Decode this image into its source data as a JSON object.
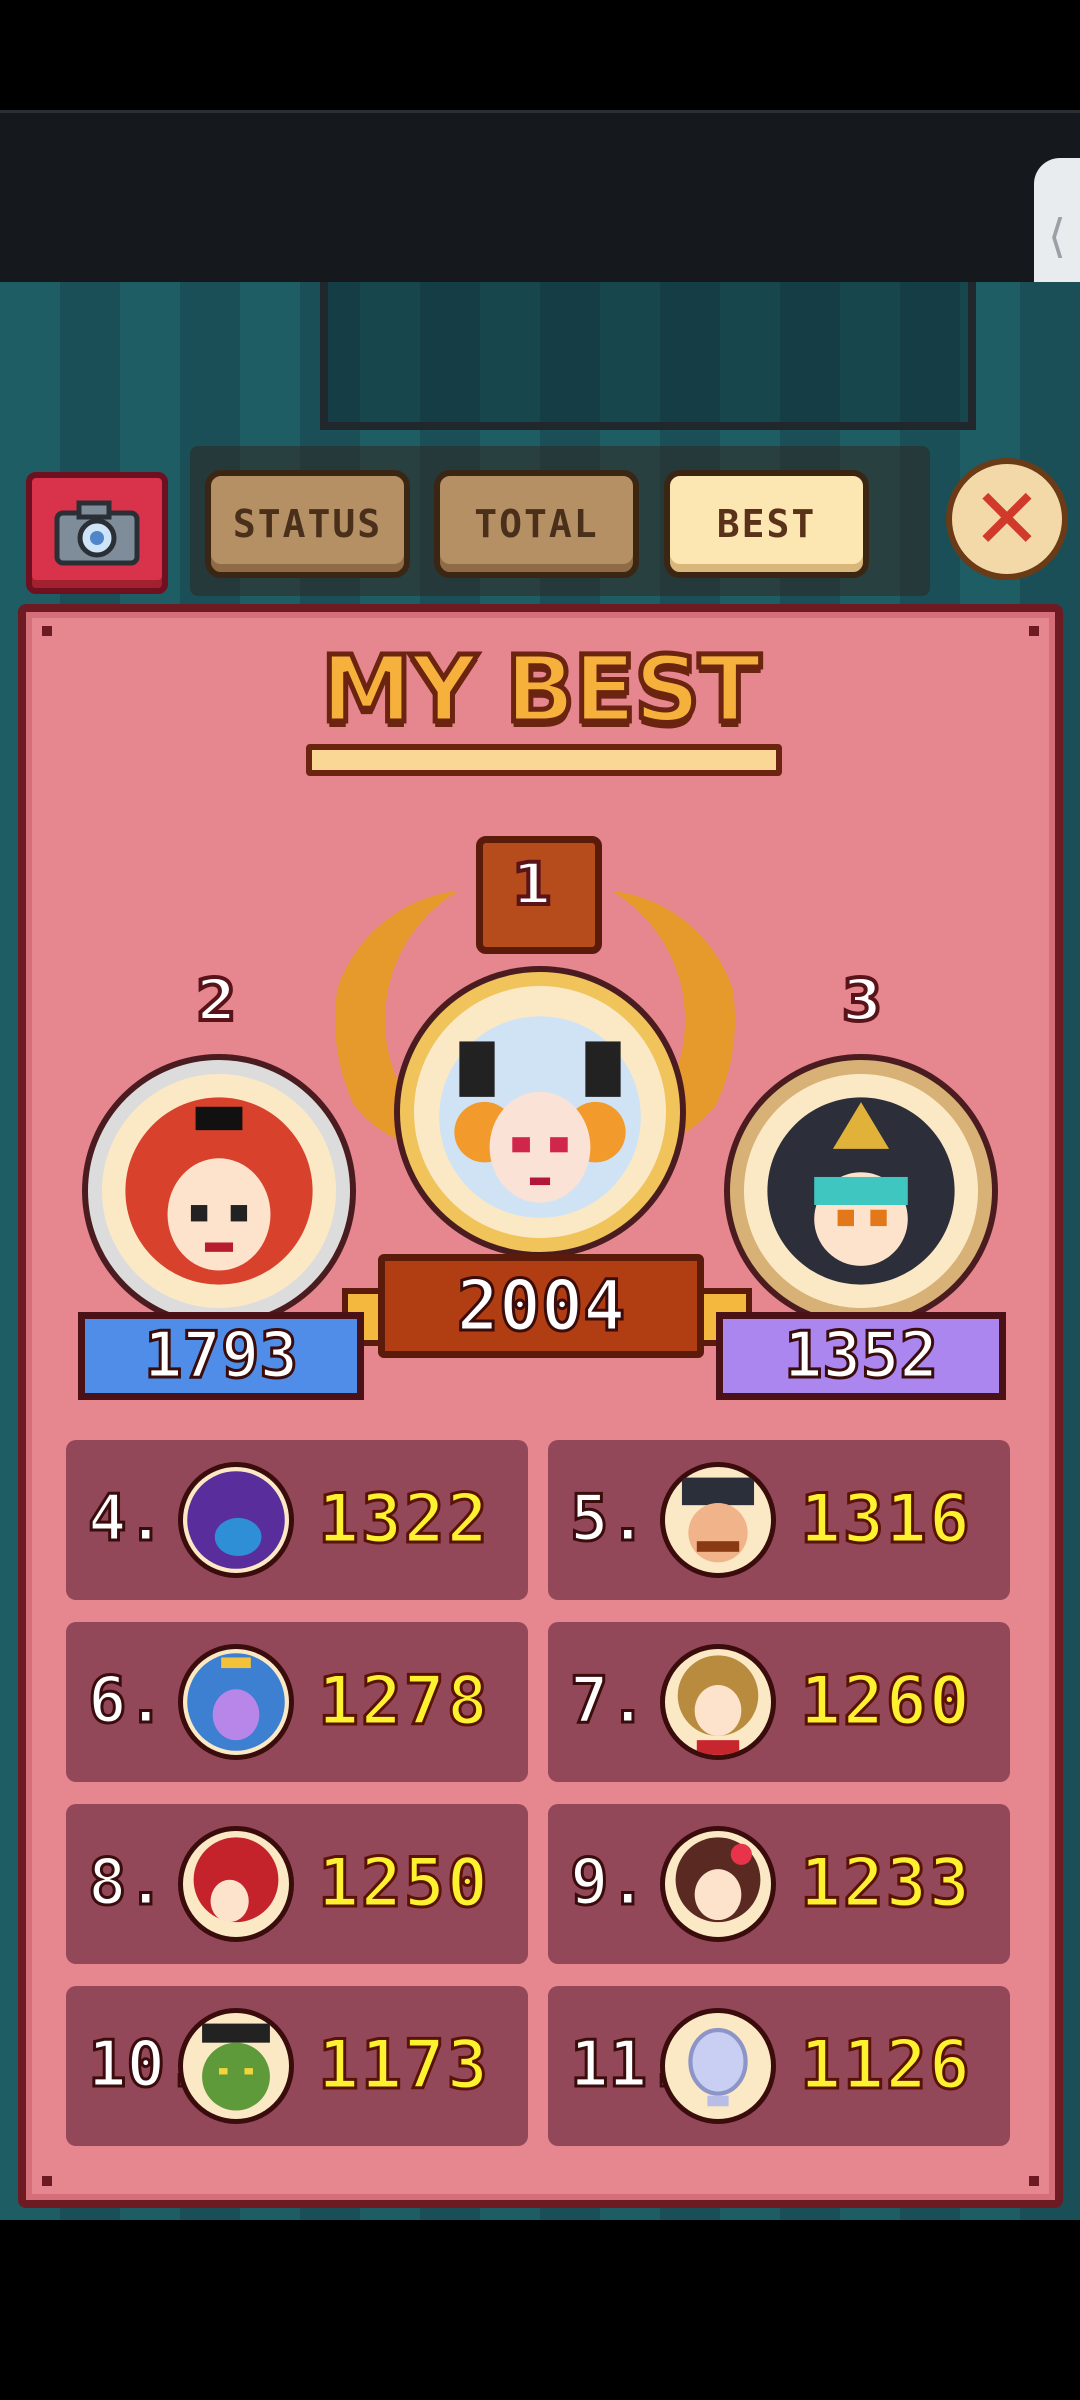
{
  "tabs": [
    {
      "label": "STATUS",
      "active": false
    },
    {
      "label": "TOTAL",
      "active": false
    },
    {
      "label": "BEST",
      "active": true
    }
  ],
  "close_icon": "✕",
  "camera_icon": "camera-icon",
  "panel": {
    "title": "MY BEST"
  },
  "podium": [
    {
      "rank": "1",
      "score": "2004",
      "character": "white-haired-horned-girl"
    },
    {
      "rank": "2",
      "score": "1793",
      "character": "red-haired-girl"
    },
    {
      "rank": "3",
      "score": "1352",
      "character": "masked-helmet-character"
    }
  ],
  "rankings": [
    {
      "rank": "4.",
      "score": "1322",
      "character": "purple-hooded-character"
    },
    {
      "rank": "5.",
      "score": "1316",
      "character": "captain-mustache"
    },
    {
      "rank": "6.",
      "score": "1278",
      "character": "purple-princess"
    },
    {
      "rank": "7.",
      "score": "1260",
      "character": "brown-haired-girl"
    },
    {
      "rank": "8.",
      "score": "1250",
      "character": "red-hood-character"
    },
    {
      "rank": "9.",
      "score": "1233",
      "character": "flower-girl"
    },
    {
      "rank": "10.",
      "score": "1173",
      "character": "green-zombie"
    },
    {
      "rank": "11.",
      "score": "1126",
      "character": "ghost-bubble"
    }
  ],
  "colors": {
    "panel_bg": "#e6868f",
    "panel_border": "#6d1a22",
    "cell_bg": "#93485a",
    "score_yellow": "#fdf22f",
    "gold": "#f0c35b",
    "blue_banner": "#4f8de8",
    "purple_banner": "#ab86ee"
  }
}
